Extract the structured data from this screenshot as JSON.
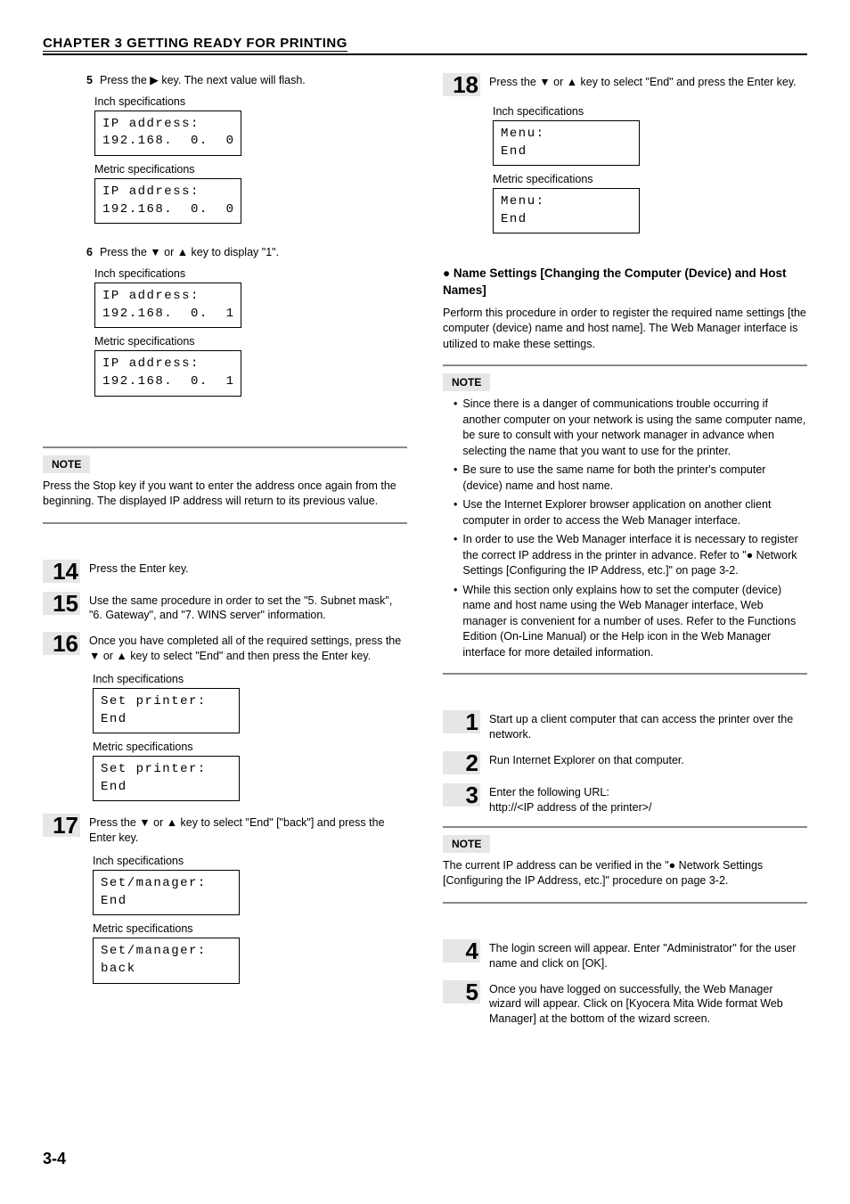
{
  "header": "CHAPTER 3  GETTING READY FOR PRINTING",
  "page_number": "3-4",
  "left": {
    "step5": {
      "num": "5",
      "text": "Press the ▶ key. The next value will flash."
    },
    "spec_inch": "Inch specifications",
    "spec_metric": "Metric specifications",
    "lcd5a_l1": "IP address:",
    "lcd5a_l2": "192.168.  0.  0",
    "lcd5b_l1": "IP address:",
    "lcd5b_l2": "192.168.  0.  0",
    "step6": {
      "num": "6",
      "text": "Press the ▼ or ▲ key to display \"1\"."
    },
    "lcd6a_l1": "IP address:",
    "lcd6a_l2": "192.168.  0.  1",
    "lcd6b_l1": "IP address:",
    "lcd6b_l2": "192.168.  0.  1",
    "note1_label": "NOTE",
    "note1_text": "Press the Stop key if you want to enter the address once again from the beginning. The displayed IP address will return to its previous value.",
    "step14": {
      "num": "14",
      "text": "Press the Enter key."
    },
    "step15": {
      "num": "15",
      "text": "Use the same procedure in order to set the \"5. Subnet mask\", \"6. Gateway\", and \"7. WINS server\" information."
    },
    "step16": {
      "num": "16",
      "text": "Once you have completed all of the required settings, press the ▼ or ▲ key to select \"End\" and then press the Enter key."
    },
    "lcd16a_l1": "Set printer:",
    "lcd16a_l2": "End",
    "lcd16b_l1": "Set printer:",
    "lcd16b_l2": "End",
    "step17": {
      "num": "17",
      "text": "Press the ▼ or ▲ key to select \"End\" [\"back\"] and press the Enter key."
    },
    "lcd17a_l1": "Set/manager:",
    "lcd17a_l2": "End",
    "lcd17b_l1": "Set/manager:",
    "lcd17b_l2": "back"
  },
  "right": {
    "step18": {
      "num": "18",
      "text": "Press the ▼ or ▲ key to select \"End\" and press the Enter key."
    },
    "spec_inch": "Inch specifications",
    "spec_metric": "Metric specifications",
    "lcd18a_l1": "Menu:",
    "lcd18a_l2": "End",
    "lcd18b_l1": "Menu:",
    "lcd18b_l2": "End",
    "heading": "● Name Settings [Changing the Computer (Device) and Host Names]",
    "intro": "Perform this procedure in order to register the required name settings [the computer (device) name and host name]. The Web Manager interface is utilized to make these settings.",
    "note2_label": "NOTE",
    "bullets": [
      "Since there is a danger of communications trouble occurring if another computer on your network is using the same computer name, be sure to consult with your network manager in advance when selecting the name that you want to use for the printer.",
      "Be sure to use the same name for both the printer's computer (device) name and host name.",
      "Use the Internet Explorer browser application on another client computer in order to access the Web Manager interface.",
      "In order to use the Web Manager interface it is necessary to register the correct IP address in the printer in advance. Refer to \"● Network Settings [Configuring the IP Address, etc.]\" on page 3-2.",
      "While this section only explains how to set the computer (device) name and host name using the Web Manager interface, Web manager is convenient for a number of uses. Refer to the Functions Edition (On-Line Manual) or the Help icon in the Web Manager interface for more detailed information."
    ],
    "step1": {
      "num": "1",
      "text": "Start up a client computer that can access the printer over the network."
    },
    "step2": {
      "num": "2",
      "text": "Run Internet Explorer on that computer."
    },
    "step3": {
      "num": "3",
      "text_l1": "Enter the following URL:",
      "text_l2": "http://<IP address of the printer>/"
    },
    "note3_label": "NOTE",
    "note3_text": "The current IP address can be verified in the \"● Network Settings [Configuring the IP Address, etc.]\" procedure on page 3-2.",
    "step4": {
      "num": "4",
      "text": "The login screen will appear. Enter \"Administrator\" for the user name and click on [OK]."
    },
    "step5": {
      "num": "5",
      "text": "Once you have logged on successfully, the Web Manager wizard will appear. Click on [Kyocera Mita Wide format Web Manager] at the bottom of the wizard screen."
    }
  }
}
